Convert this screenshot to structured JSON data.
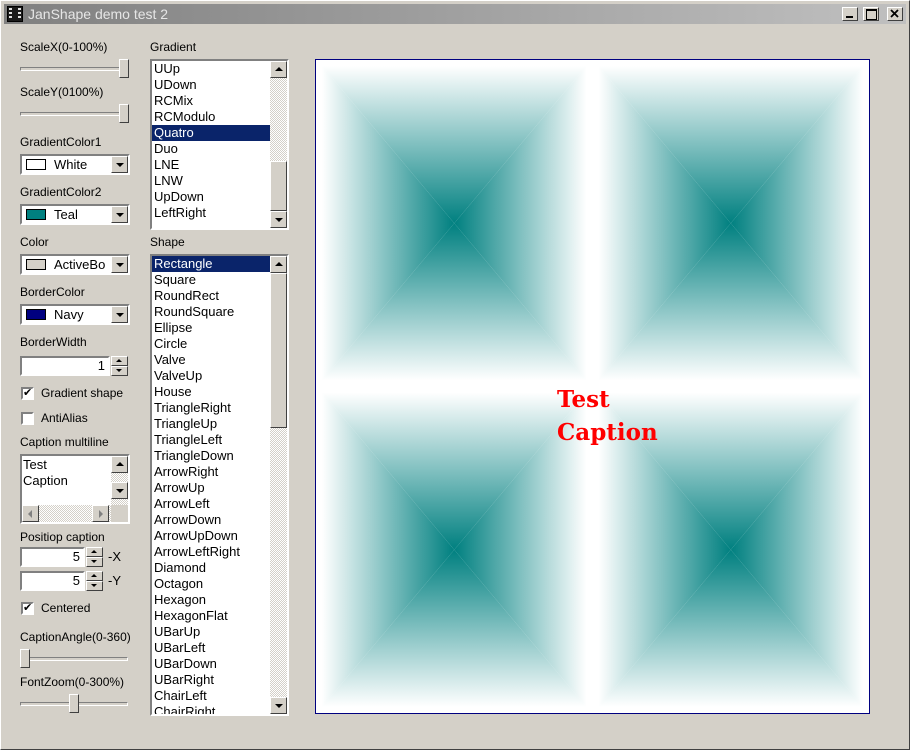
{
  "window": {
    "title": "JanShape demo test 2"
  },
  "controls": {
    "scale_x_label": "ScaleX(0-100%)",
    "scale_y_label": "ScaleY(0100%)",
    "scale_x_value": 1.0,
    "scale_y_value": 1.0,
    "gradient_color1_label": "GradientColor1",
    "gradient_color1_value": "White",
    "gradient_color1_swatch": "#ffffff",
    "gradient_color2_label": "GradientColor2",
    "gradient_color2_value": "Teal",
    "gradient_color2_swatch": "#008080",
    "color_label": "Color",
    "color_value": "ActiveBo",
    "color_swatch": "#d4d0c8",
    "border_color_label": "BorderColor",
    "border_color_value": "Navy",
    "border_color_swatch": "#000080",
    "border_width_label": "BorderWidth",
    "border_width_value": "1",
    "gradient_shape_label": "Gradient shape",
    "gradient_shape_checked": true,
    "antialias_label": "AntiAlias",
    "antialias_checked": false,
    "caption_multiline_label": "Caption multiline",
    "caption_lines": [
      "Test",
      "Caption"
    ],
    "position_caption_label": "Positiop caption",
    "pos_x_value": "5",
    "pos_x_suffix": "-X",
    "pos_y_value": "5",
    "pos_y_suffix": "-Y",
    "centered_label": "Centered",
    "centered_checked": true,
    "caption_angle_label": "CaptionAngle(0-360)",
    "caption_angle_value": 0,
    "font_zoom_label": "FontZoom(0-300%)",
    "font_zoom_value": 0.5
  },
  "gradient_list": {
    "label": "Gradient",
    "items": [
      "UUp",
      "UDown",
      "RCMix",
      "RCModulo",
      "Quatro",
      "Duo",
      "LNE",
      "LNW",
      "UpDown",
      "LeftRight"
    ],
    "selected": "Quatro"
  },
  "shape_list": {
    "label": "Shape",
    "items": [
      "Rectangle",
      "Square",
      "RoundRect",
      "RoundSquare",
      "Ellipse",
      "Circle",
      "Valve",
      "ValveUp",
      "House",
      "TriangleRight",
      "TriangleUp",
      "TriangleLeft",
      "TriangleDown",
      "ArrowRight",
      "ArrowUp",
      "ArrowLeft",
      "ArrowDown",
      "ArrowUpDown",
      "ArrowLeftRight",
      "Diamond",
      "Octagon",
      "Hexagon",
      "HexagonFlat",
      "UBarUp",
      "UBarLeft",
      "UBarDown",
      "UBarRight",
      "ChairLeft",
      "ChairRight"
    ],
    "selected": "Rectangle"
  },
  "preview": {
    "caption_lines": [
      "Test",
      "Caption"
    ],
    "caption_color": "#ff0000",
    "gradient_center_color": "#008080",
    "gradient_edge_color": "#ffffff",
    "border_color": "#000080"
  }
}
